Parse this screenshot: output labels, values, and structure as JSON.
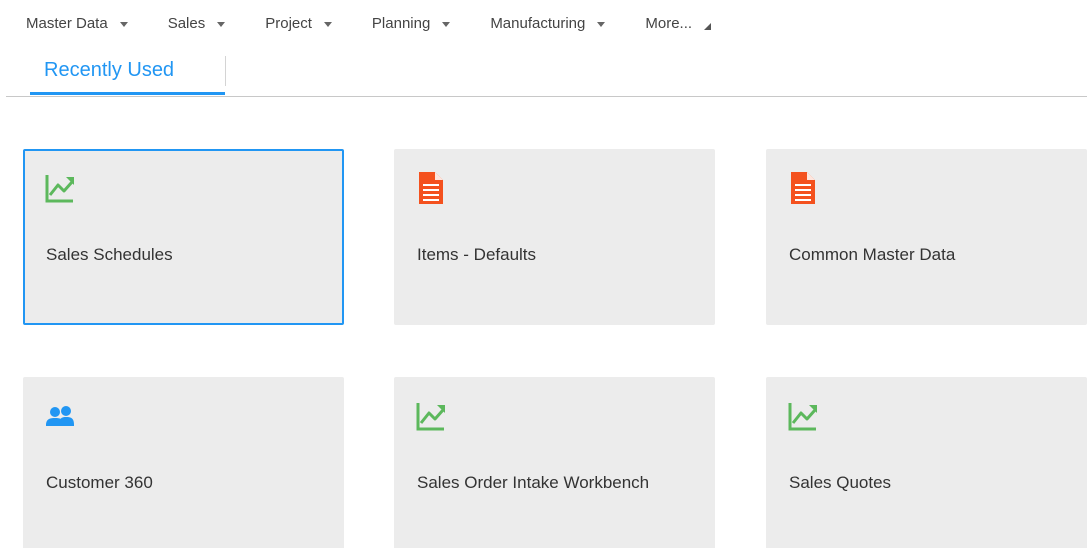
{
  "menubar": {
    "items": [
      {
        "label": "Master Data"
      },
      {
        "label": "Sales"
      },
      {
        "label": "Project"
      },
      {
        "label": "Planning"
      },
      {
        "label": "Manufacturing"
      }
    ],
    "more_label": "More..."
  },
  "tabs": [
    {
      "label": "Recently Used",
      "active": true
    }
  ],
  "tiles": [
    {
      "label": "Sales Schedules",
      "icon": "chart-trend-icon",
      "selected": true
    },
    {
      "label": "Items - Defaults",
      "icon": "document-icon"
    },
    {
      "label": "Common Master Data",
      "icon": "document-icon"
    },
    {
      "label": "Customer 360",
      "icon": "users-icon"
    },
    {
      "label": "Sales Order Intake Workbench",
      "icon": "chart-trend-icon"
    },
    {
      "label": "Sales Quotes",
      "icon": "chart-trend-icon"
    }
  ],
  "colors": {
    "accent": "#2196f3",
    "chart_icon": "#5cb85c",
    "document_icon": "#f4511e",
    "users_icon": "#2196f3",
    "tile_bg": "#ececec"
  }
}
